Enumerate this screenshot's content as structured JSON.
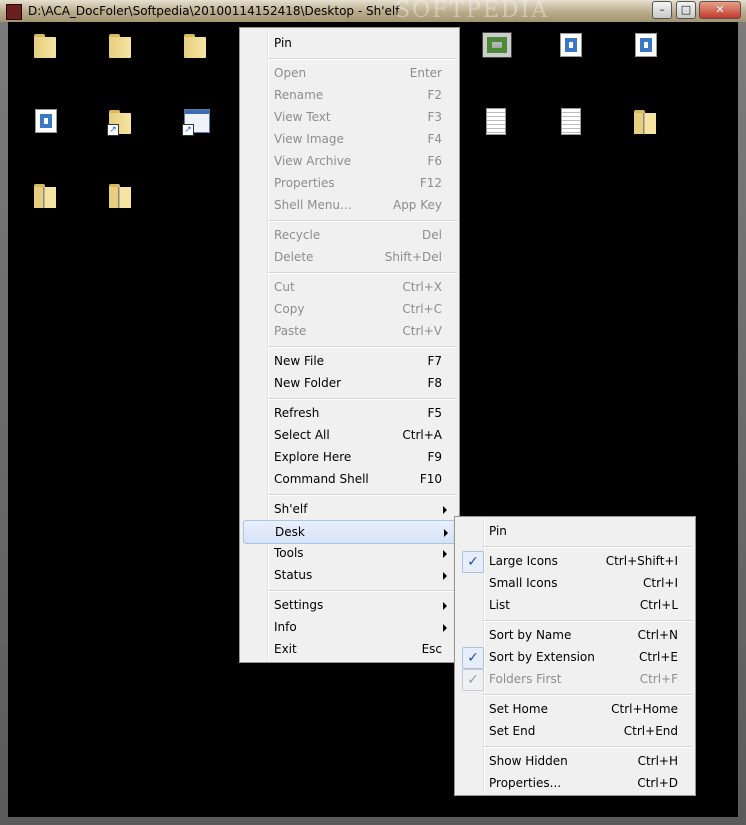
{
  "window": {
    "title": "D:\\ACA_DocFoler\\Softpedia\\20100114152418\\Desktop - Sh'elf",
    "watermark": "SOFTPEDIA",
    "controls": {
      "minimize": "–",
      "maximize": "□",
      "close": "✕"
    }
  },
  "desktop_icons": [
    "folder",
    "folder",
    "folder",
    "gallery",
    "image",
    "image",
    "image",
    "folder-shortcut",
    "app-shortcut",
    "document",
    "document",
    "zip",
    "zip",
    "zip"
  ],
  "main_menu": [
    {
      "label": "Pin",
      "shortcut": "",
      "disabled": false,
      "submenu": false
    },
    {
      "label": "Open",
      "shortcut": "Enter",
      "disabled": true,
      "submenu": false
    },
    {
      "label": "Rename",
      "shortcut": "F2",
      "disabled": true,
      "submenu": false
    },
    {
      "label": "View Text",
      "shortcut": "F3",
      "disabled": true,
      "submenu": false
    },
    {
      "label": "View Image",
      "shortcut": "F4",
      "disabled": true,
      "submenu": false
    },
    {
      "label": "View Archive",
      "shortcut": "F6",
      "disabled": true,
      "submenu": false
    },
    {
      "label": "Properties",
      "shortcut": "F12",
      "disabled": true,
      "submenu": false
    },
    {
      "label": "Shell Menu...",
      "shortcut": "App Key",
      "disabled": true,
      "submenu": false
    },
    {
      "label": "Recycle",
      "shortcut": "Del",
      "disabled": true,
      "submenu": false
    },
    {
      "label": "Delete",
      "shortcut": "Shift+Del",
      "disabled": true,
      "submenu": false
    },
    {
      "label": "Cut",
      "shortcut": "Ctrl+X",
      "disabled": true,
      "submenu": false
    },
    {
      "label": "Copy",
      "shortcut": "Ctrl+C",
      "disabled": true,
      "submenu": false
    },
    {
      "label": "Paste",
      "shortcut": "Ctrl+V",
      "disabled": true,
      "submenu": false
    },
    {
      "label": "New File",
      "shortcut": "F7",
      "disabled": false,
      "submenu": false
    },
    {
      "label": "New Folder",
      "shortcut": "F8",
      "disabled": false,
      "submenu": false
    },
    {
      "label": "Refresh",
      "shortcut": "F5",
      "disabled": false,
      "submenu": false
    },
    {
      "label": "Select All",
      "shortcut": "Ctrl+A",
      "disabled": false,
      "submenu": false
    },
    {
      "label": "Explore Here",
      "shortcut": "F9",
      "disabled": false,
      "submenu": false
    },
    {
      "label": "Command Shell",
      "shortcut": "F10",
      "disabled": false,
      "submenu": false
    },
    {
      "label": "Sh'elf",
      "shortcut": "",
      "disabled": false,
      "submenu": true
    },
    {
      "label": "Desk",
      "shortcut": "",
      "disabled": false,
      "submenu": true,
      "highlighted": true
    },
    {
      "label": "Tools",
      "shortcut": "",
      "disabled": false,
      "submenu": true
    },
    {
      "label": "Status",
      "shortcut": "",
      "disabled": false,
      "submenu": true
    },
    {
      "label": "Settings",
      "shortcut": "",
      "disabled": false,
      "submenu": true
    },
    {
      "label": "Info",
      "shortcut": "",
      "disabled": false,
      "submenu": true
    },
    {
      "label": "Exit",
      "shortcut": "Esc",
      "disabled": false,
      "submenu": false
    }
  ],
  "desk_submenu": [
    {
      "label": "Pin",
      "shortcut": "",
      "checked": false,
      "disabled": false
    },
    {
      "label": "Large Icons",
      "shortcut": "Ctrl+Shift+I",
      "checked": true,
      "disabled": false
    },
    {
      "label": "Small Icons",
      "shortcut": "Ctrl+I",
      "checked": false,
      "disabled": false
    },
    {
      "label": "List",
      "shortcut": "Ctrl+L",
      "checked": false,
      "disabled": false
    },
    {
      "label": "Sort by Name",
      "shortcut": "Ctrl+N",
      "checked": false,
      "disabled": false
    },
    {
      "label": "Sort by Extension",
      "shortcut": "Ctrl+E",
      "checked": true,
      "disabled": false
    },
    {
      "label": "Folders First",
      "shortcut": "Ctrl+F",
      "checked": true,
      "disabled": true
    },
    {
      "label": "Set Home",
      "shortcut": "Ctrl+Home",
      "checked": false,
      "disabled": false
    },
    {
      "label": "Set End",
      "shortcut": "Ctrl+End",
      "checked": false,
      "disabled": false
    },
    {
      "label": "Show Hidden",
      "shortcut": "Ctrl+H",
      "checked": false,
      "disabled": false
    },
    {
      "label": "Properties...",
      "shortcut": "Ctrl+D",
      "checked": false,
      "disabled": false
    }
  ]
}
